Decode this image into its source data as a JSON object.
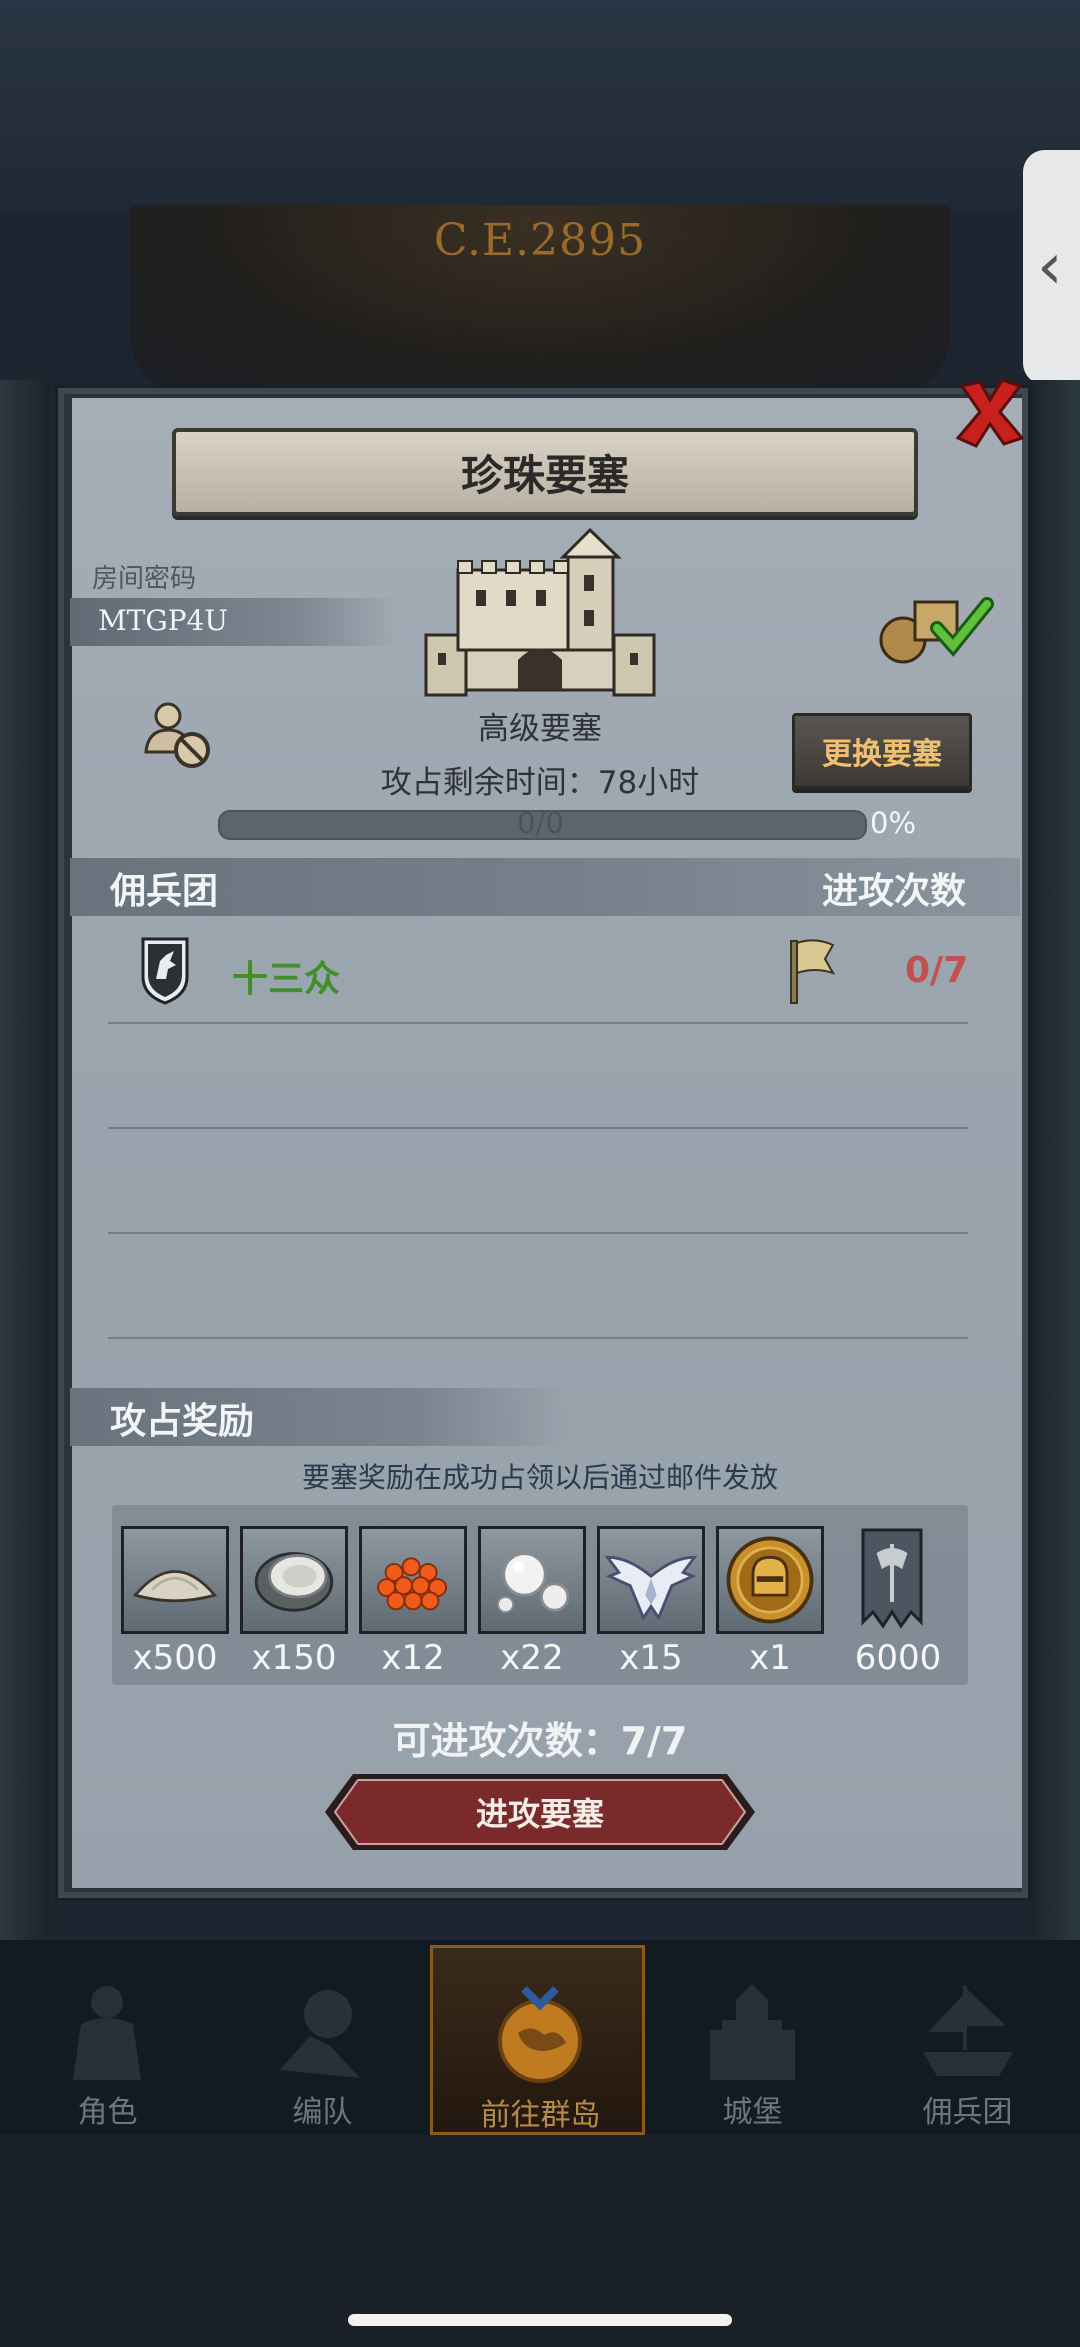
{
  "background": {
    "era": "C.E.2895"
  },
  "dialog": {
    "title": "珍珠要塞",
    "room_label": "房间密码",
    "room_code": "MTGP4U",
    "fortress_level": "高级要塞",
    "change_button": "更换要塞",
    "timer_text": "攻占剩余时间：78小时",
    "progress": {
      "text": "0/0",
      "percent_label": "0%",
      "fraction": 0
    },
    "mercenary_header": "佣兵团",
    "attack_count_header": "进攻次数",
    "mercenary": {
      "name": "十三众",
      "attacks": "0/7"
    },
    "reward_header": "攻占奖励",
    "reward_note": "要塞奖励在成功占领以后通过邮件发放",
    "rewards": [
      {
        "icon": "sand-pile-icon",
        "qty": "x500"
      },
      {
        "icon": "oyster-icon",
        "qty": "x150"
      },
      {
        "icon": "fish-roe-icon",
        "qty": "x12"
      },
      {
        "icon": "pearls-icon",
        "qty": "x22"
      },
      {
        "icon": "winged-emblem-icon",
        "qty": "x15"
      },
      {
        "icon": "knight-helmet-medal-icon",
        "qty": "x1"
      },
      {
        "icon": "guild-banner-icon",
        "qty": "6000"
      }
    ],
    "attempts_text": "可进攻次数：7/7",
    "attack_button": "进攻要塞"
  },
  "nav": [
    {
      "label": "角色",
      "icon": "character-icon"
    },
    {
      "label": "编队",
      "icon": "formation-icon"
    },
    {
      "label": "前往群岛",
      "icon": "islands-map-icon",
      "active": true
    },
    {
      "label": "城堡",
      "icon": "castle-icon"
    },
    {
      "label": "佣兵团",
      "icon": "mercenary-ship-icon"
    }
  ],
  "colors": {
    "accent_gold": "#f0c070",
    "merc_green": "#3f8f2a",
    "count_red": "#c25050",
    "attack_button": "#7a2a2a"
  }
}
